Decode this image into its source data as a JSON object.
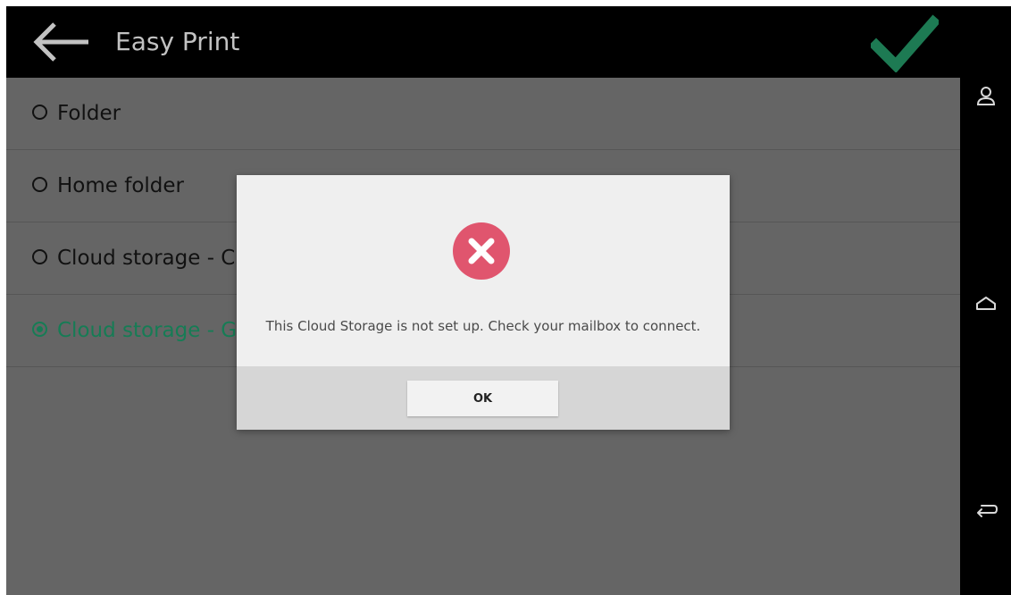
{
  "header": {
    "title": "Easy Print",
    "back_icon": "arrow-left-icon",
    "confirm_icon": "checkmark-icon"
  },
  "list": {
    "items": [
      {
        "label": "Folder",
        "selected": false
      },
      {
        "label": "Home folder",
        "selected": false
      },
      {
        "label": "Cloud storage - C",
        "selected": false
      },
      {
        "label": "Cloud storage - G",
        "selected": true
      }
    ]
  },
  "dialog": {
    "icon": "error-x-icon",
    "message": "This Cloud Storage is not set up. Check your mailbox to connect.",
    "ok_label": "OK"
  },
  "navbar": {
    "icons": [
      "user-icon",
      "home-icon",
      "back-icon"
    ]
  },
  "colors": {
    "accent": "#167c55",
    "confirm_check": "#1d7a53",
    "error": "#e0556e",
    "overlay_bg": "#656565",
    "header_bg": "#000000"
  }
}
